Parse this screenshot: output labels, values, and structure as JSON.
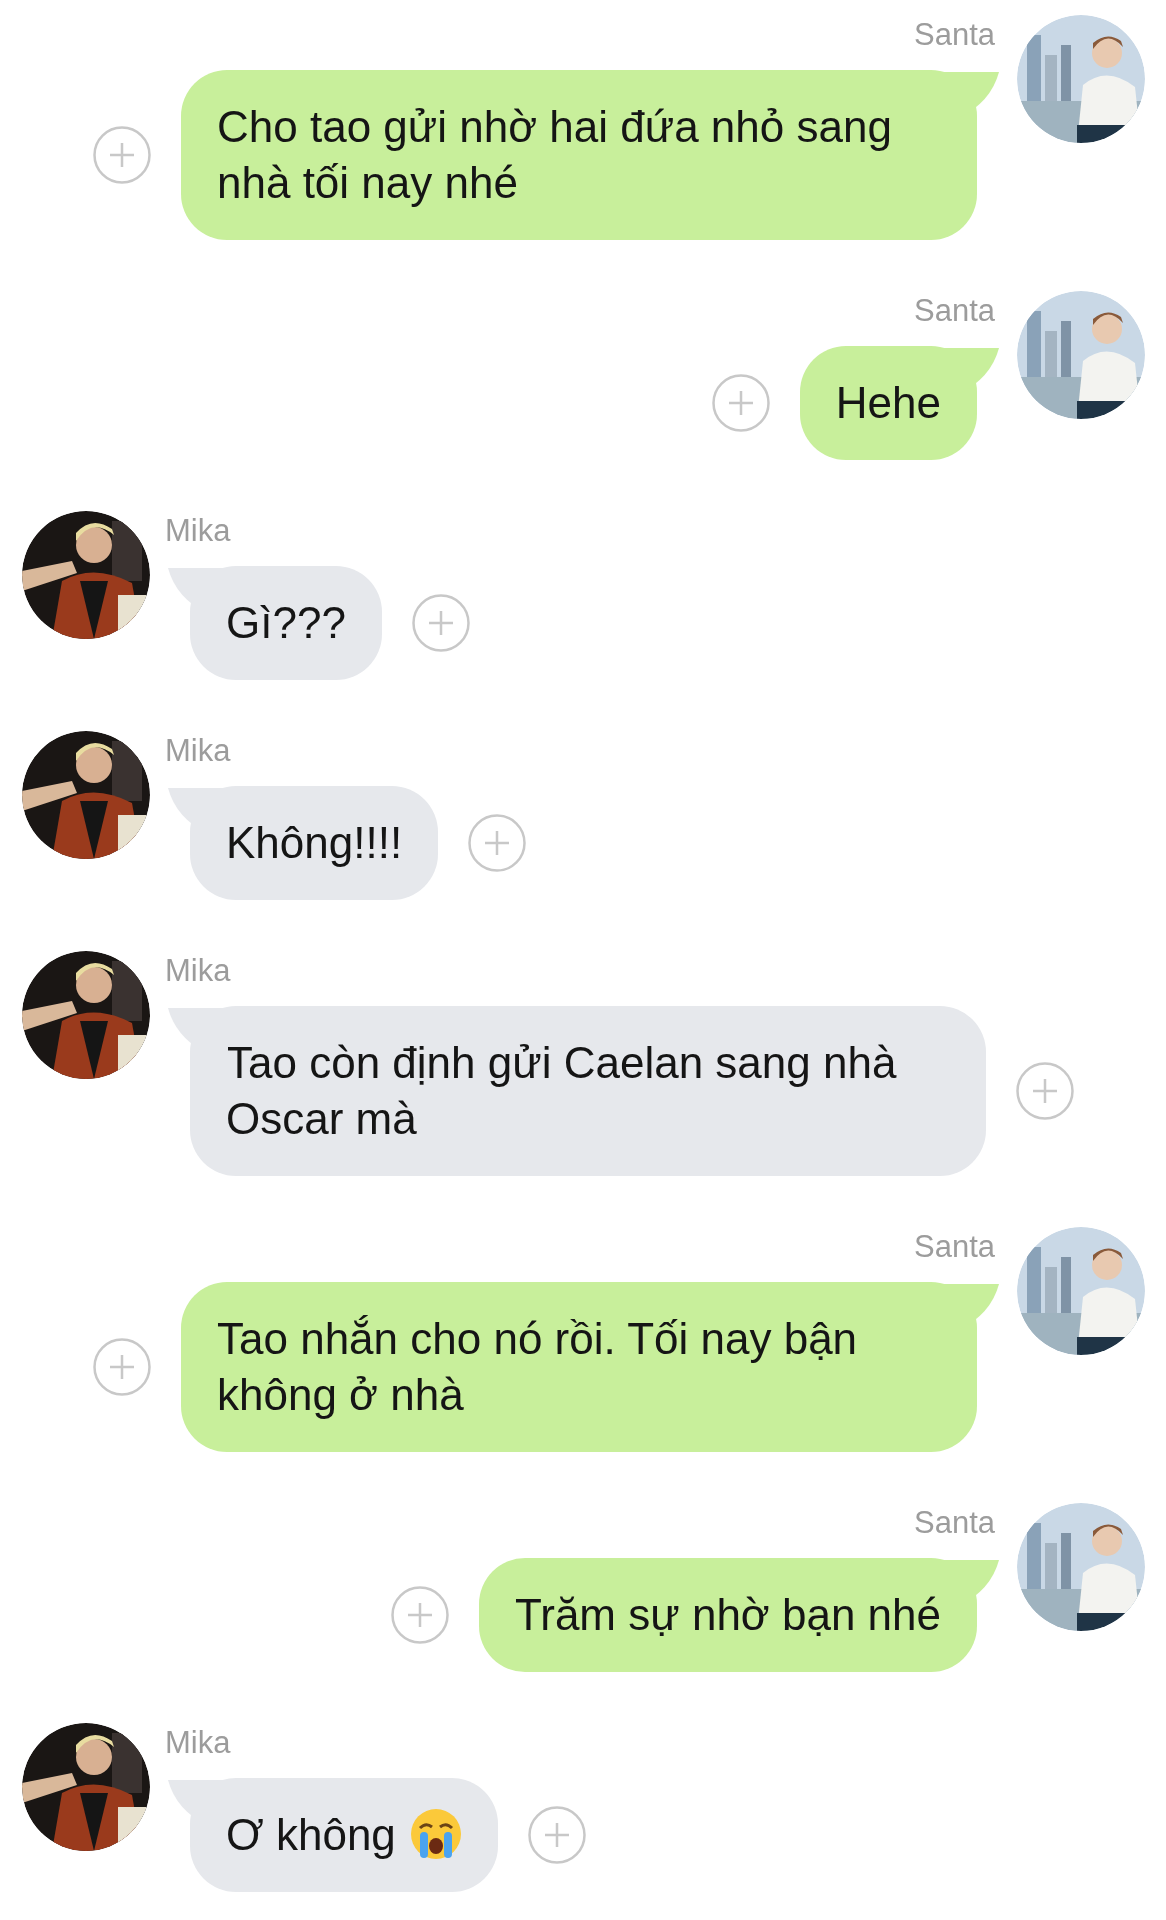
{
  "messages": [
    {
      "sender": "Santa",
      "outgoing": true,
      "text": "Cho tao gửi nhờ hai đứa nhỏ sang nhà tối nay nhé",
      "crying_emoji": false
    },
    {
      "sender": "Santa",
      "outgoing": true,
      "text": "Hehe",
      "crying_emoji": false
    },
    {
      "sender": "Mika",
      "outgoing": false,
      "text": "Gì???",
      "crying_emoji": false
    },
    {
      "sender": "Mika",
      "outgoing": false,
      "text": "Không!!!!",
      "crying_emoji": false
    },
    {
      "sender": "Mika",
      "outgoing": false,
      "text": "Tao còn định gửi Caelan sang nhà Oscar mà",
      "crying_emoji": false
    },
    {
      "sender": "Santa",
      "outgoing": true,
      "text": "Tao nhắn cho nó rồi. Tối nay bận không ở nhà",
      "crying_emoji": false
    },
    {
      "sender": "Santa",
      "outgoing": true,
      "text": "Trăm sự nhờ bạn nhé",
      "crying_emoji": false
    },
    {
      "sender": "Mika",
      "outgoing": false,
      "text": "Ơ không",
      "crying_emoji": true
    }
  ]
}
